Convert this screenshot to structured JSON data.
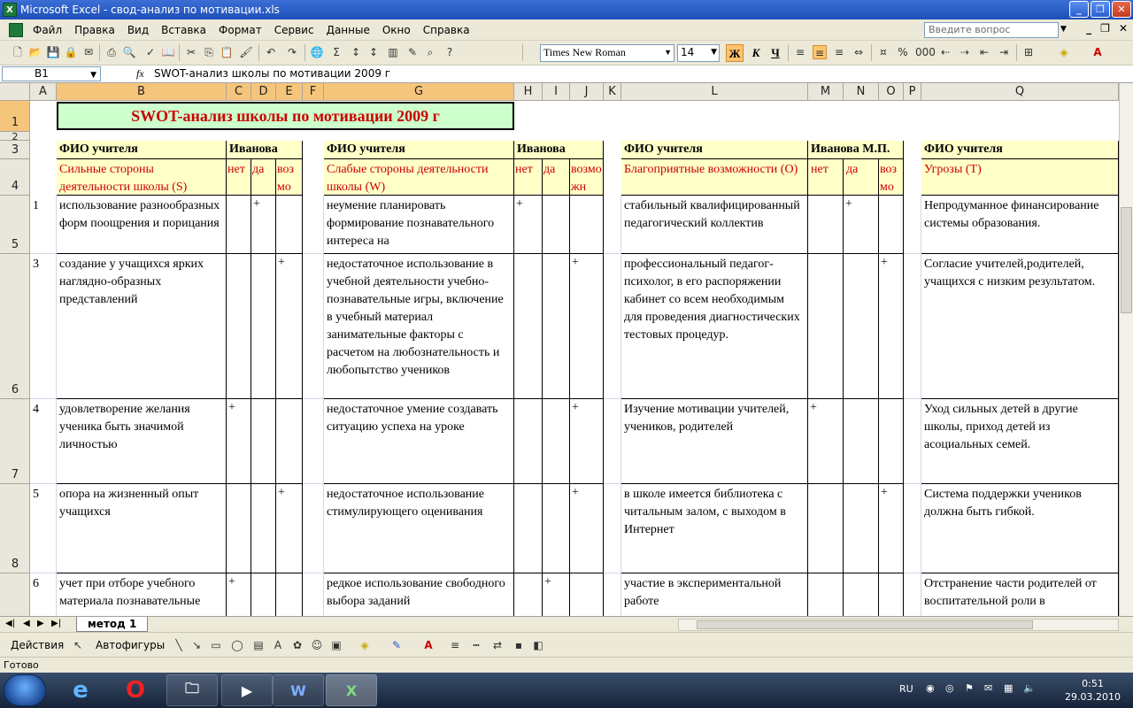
{
  "window": {
    "title": "Microsoft Excel - свод-анализ по мотивации.xls"
  },
  "menu": {
    "items": [
      "Файл",
      "Правка",
      "Вид",
      "Вставка",
      "Формат",
      "Сервис",
      "Данные",
      "Окно",
      "Справка"
    ],
    "help_placeholder": "Введите вопрос"
  },
  "toolbar": {
    "font": "Times New Roman",
    "size": "14",
    "bold": "Ж",
    "italic": "К",
    "underline": "Ч"
  },
  "formula_bar": {
    "name_box": "B1",
    "fx": "fx",
    "content": "SWOT-анализ школы по мотивации  2009 г"
  },
  "columns": [
    "A",
    "B",
    "C",
    "D",
    "E",
    "F",
    "G",
    "H",
    "I",
    "J",
    "K",
    "L",
    "M",
    "N",
    "O",
    "P",
    "Q"
  ],
  "rows": [
    "1",
    "2",
    "3",
    "4",
    "5",
    "6",
    "7",
    "8",
    ""
  ],
  "sheet": {
    "title": "SWOT-анализ школы по мотивации  2009 г",
    "fio_label": "ФИО учителя",
    "teacher_1": "Иванова",
    "teacher_2": "Иванова",
    "teacher_3": "Иванова М.П.",
    "col_strengths": "Сильные стороны деятельности школы   (S)",
    "col_weaknesses": "Слабые стороны деятельности школы   (W)",
    "col_opportunities": "Благоприятные возможности (O)",
    "col_threats": "Угрозы (T)",
    "net": "нет",
    "da": "да",
    "vozmo": "возмо",
    "vozmozhn": "возможн",
    "data_rows": [
      {
        "num": "1",
        "s": "использование разнообразных форм поощрения и порицания",
        "s_mark": "da",
        "w": "неумение планировать формирование познавательного интереса на",
        "w_mark": "net",
        "o": "стабильный квалифицированный педагогический коллектив",
        "o_mark": "da",
        "t": "Непродуманное финансирование системы образования."
      },
      {
        "num": "3",
        "s": "создание у учащихся ярких наглядно-образных представлений",
        "s_mark": "vozmo",
        "w": "недостаточное использование в учебной деятельности учебно-познавательные игры, включение в учебный материал занимательные факторы с расчетом на любознательность и любопытство учеников",
        "w_mark": "vozmo",
        "o": "профессиональный педагог-психолог, в его распоряжении кабинет со всем необходимым для проведения диагностических тестовых процедур.",
        "o_mark": "vozmo",
        "t": "Согласие учителей,родителей, учащихся с низким результатом."
      },
      {
        "num": "4",
        "s": "удовлетворение желания ученика быть значимой личностью",
        "s_mark": "net",
        "w": "недостаточное умение создавать ситуацию успеха на уроке",
        "w_mark": "vozmo",
        "o": "Изучение мотивации учителей, учеников, родителей",
        "o_mark": "net",
        "t": "Уход сильных детей в другие школы, приход детей из асоциальных семей."
      },
      {
        "num": "5",
        "s": "опора на жизненный опыт учащихся",
        "s_mark": "vozmo",
        "w": "недостаточное использование стимулирующего оценивания",
        "w_mark": "vozmo",
        "o": "в школе имеется библиотека с читальным залом, с выходом в Интернет",
        "o_mark": "vozmo",
        "t": "Система поддержки учеников должна быть гибкой."
      },
      {
        "num": "6",
        "s": "учет при отборе учебного материала познавательные",
        "s_mark": "net",
        "w": "редкое использование свободного выбора заданий",
        "w_mark": "da",
        "o": "участие в экспериментальной работе",
        "o_mark": "",
        "t": "Отстранение части родителей от воспитательной роли в"
      }
    ],
    "plus": "+"
  },
  "tabs": {
    "sheet1": "метод 1"
  },
  "drawing": {
    "actions": "Действия",
    "autoshapes": "Автофигуры"
  },
  "status": {
    "text": "Готово"
  },
  "taskbar": {
    "lang": "RU",
    "time": "0:51",
    "date": "29.03.2010"
  }
}
